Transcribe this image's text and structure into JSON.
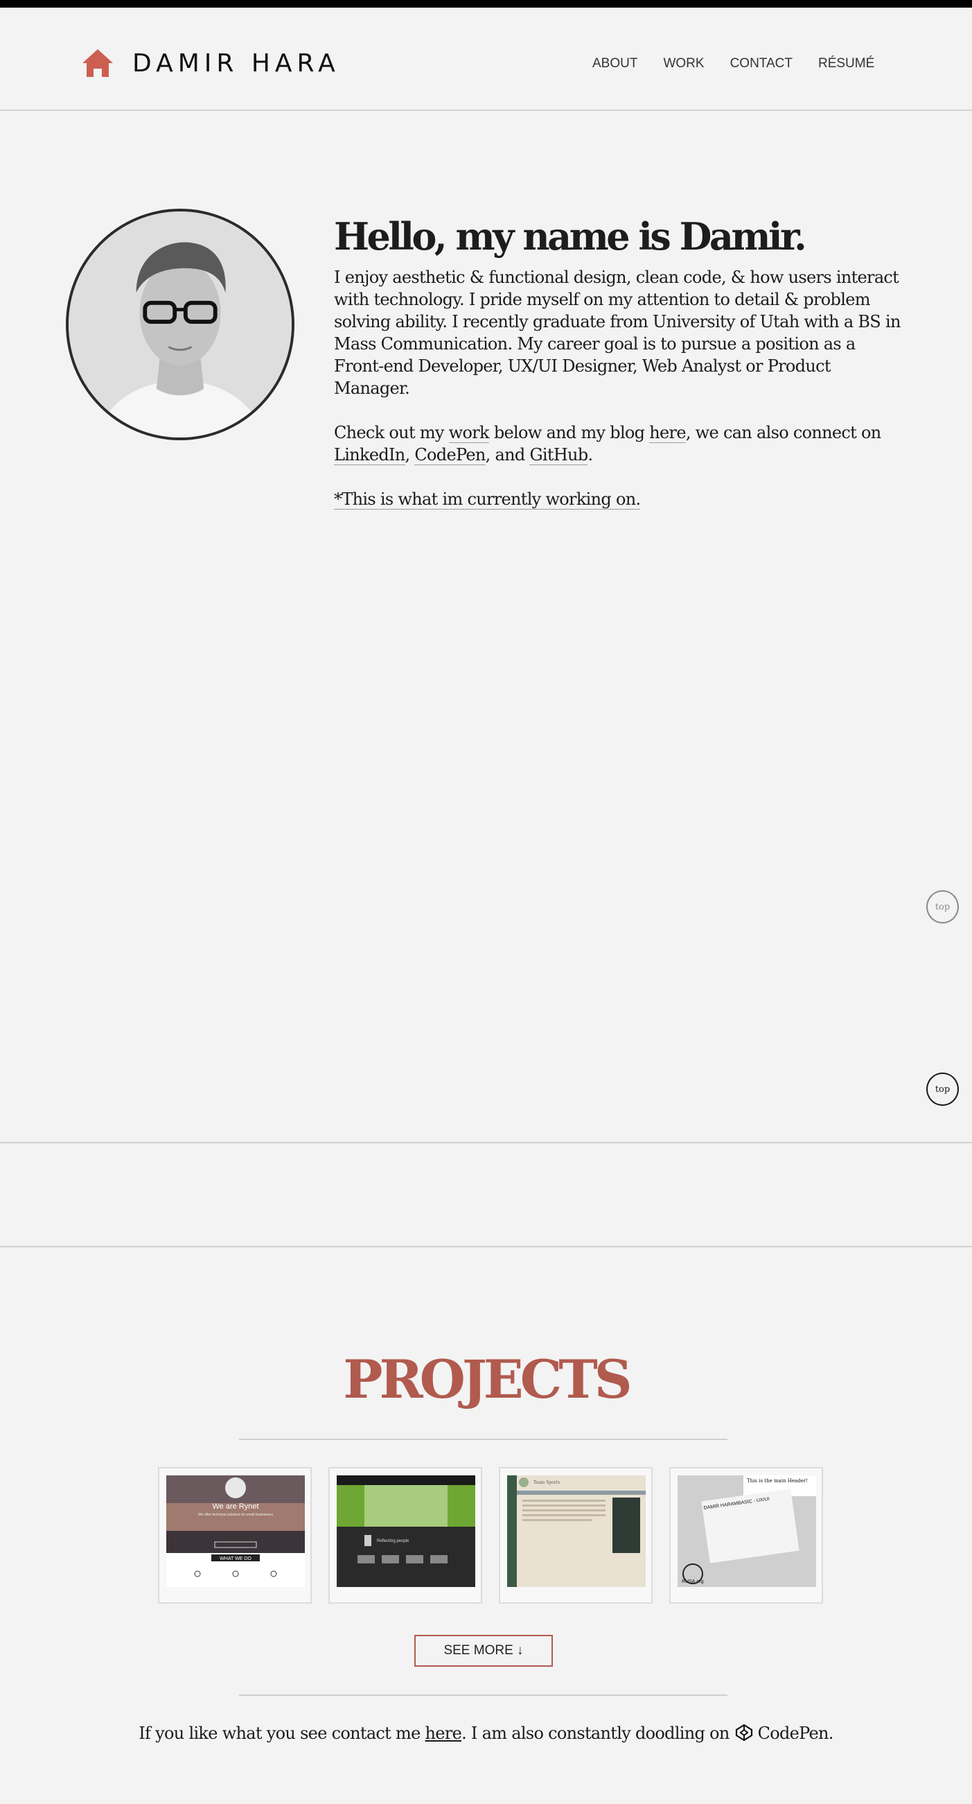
{
  "header": {
    "brand": "DAMIR HARA",
    "nav": [
      "ABOUT",
      "WORK",
      "CONTACT",
      "RÉSUMÉ"
    ]
  },
  "about": {
    "heading": "Hello, my name is Damir.",
    "bio": "I enjoy aesthetic & functional design, clean code, & how users interact with technology. I pride myself on my attention to detail & problem solving ability. I recently graduate from University of Utah with a BS in Mass Communication. My career goal is to pursue a position as a Front-end Developer, UX/UI Designer, Web Analyst or Product Manager.",
    "links": {
      "t1": "Check out my ",
      "work": "work",
      "t2": " below and my blog ",
      "here": "here",
      "t3": ", we can also connect on ",
      "linkedin": "LinkedIn",
      "t4": ", ",
      "codepen": "CodePen",
      "t5": ", and ",
      "github": "GitHub",
      "t6": "."
    },
    "current_work": "*This is what im currently working on."
  },
  "scroll_top": [
    "top",
    "top"
  ],
  "projects": {
    "title": "PROJECTS",
    "see_more": "SEE MORE ↓",
    "thumbs": [
      {
        "heading": "We are Rynet",
        "sub": "We offer technical solutions for small businesses",
        "button": "WHAT WE DO"
      },
      {
        "caption": "Reflecting people"
      },
      {
        "caption": "Team Sports"
      },
      {
        "heading": "This is the main Header!",
        "sub": "DAMIR HARAMBASIC - UX/UI",
        "badge": "RUSA.org"
      }
    ]
  },
  "footer": {
    "t1": "If you like what you see contact me ",
    "here": "here",
    "t2": ". I am also constantly doodling on ",
    "codepen": "CodePen."
  },
  "colors": {
    "accent": "#b15a4e",
    "home_icon": "#cc5f51",
    "background": "#f3f3f3"
  }
}
